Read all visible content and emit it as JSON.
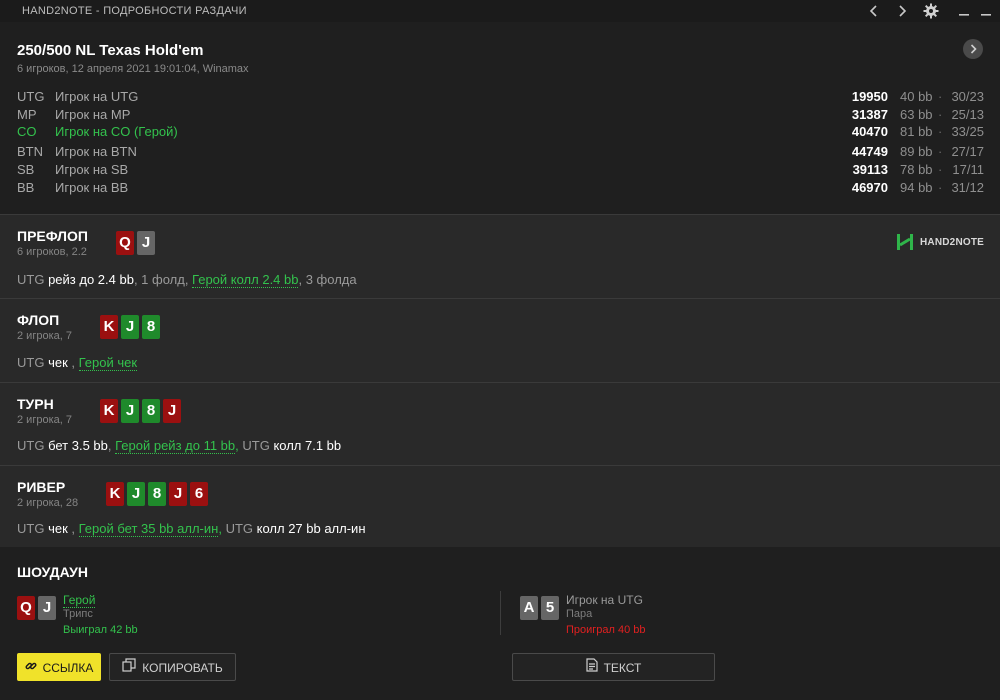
{
  "window": {
    "title": "HAND2NOTE - ПОДРОБНОСТИ РАЗДАЧИ"
  },
  "icons": {
    "prev": "chevron-left-icon",
    "next": "chevron-right-icon",
    "settings": "gear-icon",
    "minimize": "minimize-icon",
    "maximize": "maximize-icon"
  },
  "header": {
    "title": "250/500 NL Texas Hold'em",
    "subtitle": "6 игроков, 12 апреля 2021 19:01:04, Winamax"
  },
  "players": [
    {
      "pos": "UTG",
      "name": "Игрок на UTG",
      "stack": "19950",
      "bb": "40 bb",
      "ratio": "30/23",
      "hero": false
    },
    {
      "pos": "MP",
      "name": "Игрок на MP",
      "stack": "31387",
      "bb": "63 bb",
      "ratio": "25/13",
      "hero": false
    },
    {
      "pos": "CO",
      "name": "Игрок на CO (Герой)",
      "stack": "40470",
      "bb": "81 bb",
      "ratio": "33/25",
      "hero": true
    },
    {
      "pos": "BTN",
      "name": "Игрок на BTN",
      "stack": "44749",
      "bb": "89 bb",
      "ratio": "27/17",
      "hero": false
    },
    {
      "pos": "SB",
      "name": "Игрок на SB",
      "stack": "39113",
      "bb": "78 bb",
      "ratio": "17/11",
      "hero": false
    },
    {
      "pos": "BB",
      "name": "Игрок на BB",
      "stack": "46970",
      "bb": "94 bb",
      "ratio": "31/12",
      "hero": false
    }
  ],
  "separator_dot": "·",
  "logo": {
    "text": "HAND2NOTE"
  },
  "streets": {
    "preflop": {
      "name": "ПРЕФЛОП",
      "info": "6 игроков, 2.2",
      "cards": [
        {
          "rank": "Q",
          "color": "red"
        },
        {
          "rank": "J",
          "color": "grey"
        }
      ],
      "action": {
        "p1": "UTG",
        "a1": " рейз до 2.4 bb",
        "g1": ", 1 фолд, ",
        "h1": "Герой колл 2.4 bb",
        "g2": ", 3 фолда"
      }
    },
    "flop": {
      "name": "ФЛОП",
      "info": "2 игрока, 7",
      "cards": [
        {
          "rank": "K",
          "color": "red"
        },
        {
          "rank": "J",
          "color": "green"
        },
        {
          "rank": "8",
          "color": "green"
        }
      ],
      "action": {
        "p1": "UTG",
        "a1": " чек",
        "g1": " , ",
        "h1": "Герой чек"
      }
    },
    "turn": {
      "name": "ТУРН",
      "info": "2 игрока, 7",
      "cards": [
        {
          "rank": "K",
          "color": "red"
        },
        {
          "rank": "J",
          "color": "green"
        },
        {
          "rank": "8",
          "color": "green"
        },
        {
          "rank": "J",
          "color": "red"
        }
      ],
      "action": {
        "p1": "UTG",
        "a1": " бет 3.5 bb",
        "g1": ", ",
        "h1": "Герой рейз до 11 bb",
        "ht": ",",
        "p2": " UTG",
        "a2": " колл 7.1 bb"
      }
    },
    "river": {
      "name": "РИВЕР",
      "info": "2 игрока, 28",
      "cards": [
        {
          "rank": "K",
          "color": "red"
        },
        {
          "rank": "J",
          "color": "green"
        },
        {
          "rank": "8",
          "color": "green"
        },
        {
          "rank": "J",
          "color": "red"
        },
        {
          "rank": "6",
          "color": "red"
        }
      ],
      "action": {
        "p1": "UTG",
        "a1": " чек",
        "g1": " , ",
        "h1": "Герой бет 35 bb алл-ин",
        "ht": ",",
        "p2": " UTG",
        "a2": " колл 27 bb алл-ин"
      }
    }
  },
  "showdown": {
    "title": "ШОУДАУН",
    "hero": {
      "name": "Герой",
      "hand": "Трипс",
      "result": "Выиграл 42 bb",
      "cards": [
        {
          "rank": "Q",
          "color": "red"
        },
        {
          "rank": "J",
          "color": "grey"
        }
      ]
    },
    "villain": {
      "name": "Игрок на UTG",
      "hand": "Пара",
      "result": "Проиграл 40 bb",
      "cards": [
        {
          "rank": "A",
          "color": "grey"
        },
        {
          "rank": "5",
          "color": "grey"
        }
      ]
    }
  },
  "buttons": {
    "link": "ССЫЛКА",
    "copy": "КОПИРОВАТЬ",
    "text": "ТЕКСТ"
  },
  "colors": {
    "hero_green": "#33c24d",
    "win_green": "#33c24d",
    "loss_red": "#e02020",
    "accent_yellow": "#f0e22a",
    "card_red": "#9b1010",
    "card_green": "#1f8a2b",
    "card_grey": "#666666"
  }
}
